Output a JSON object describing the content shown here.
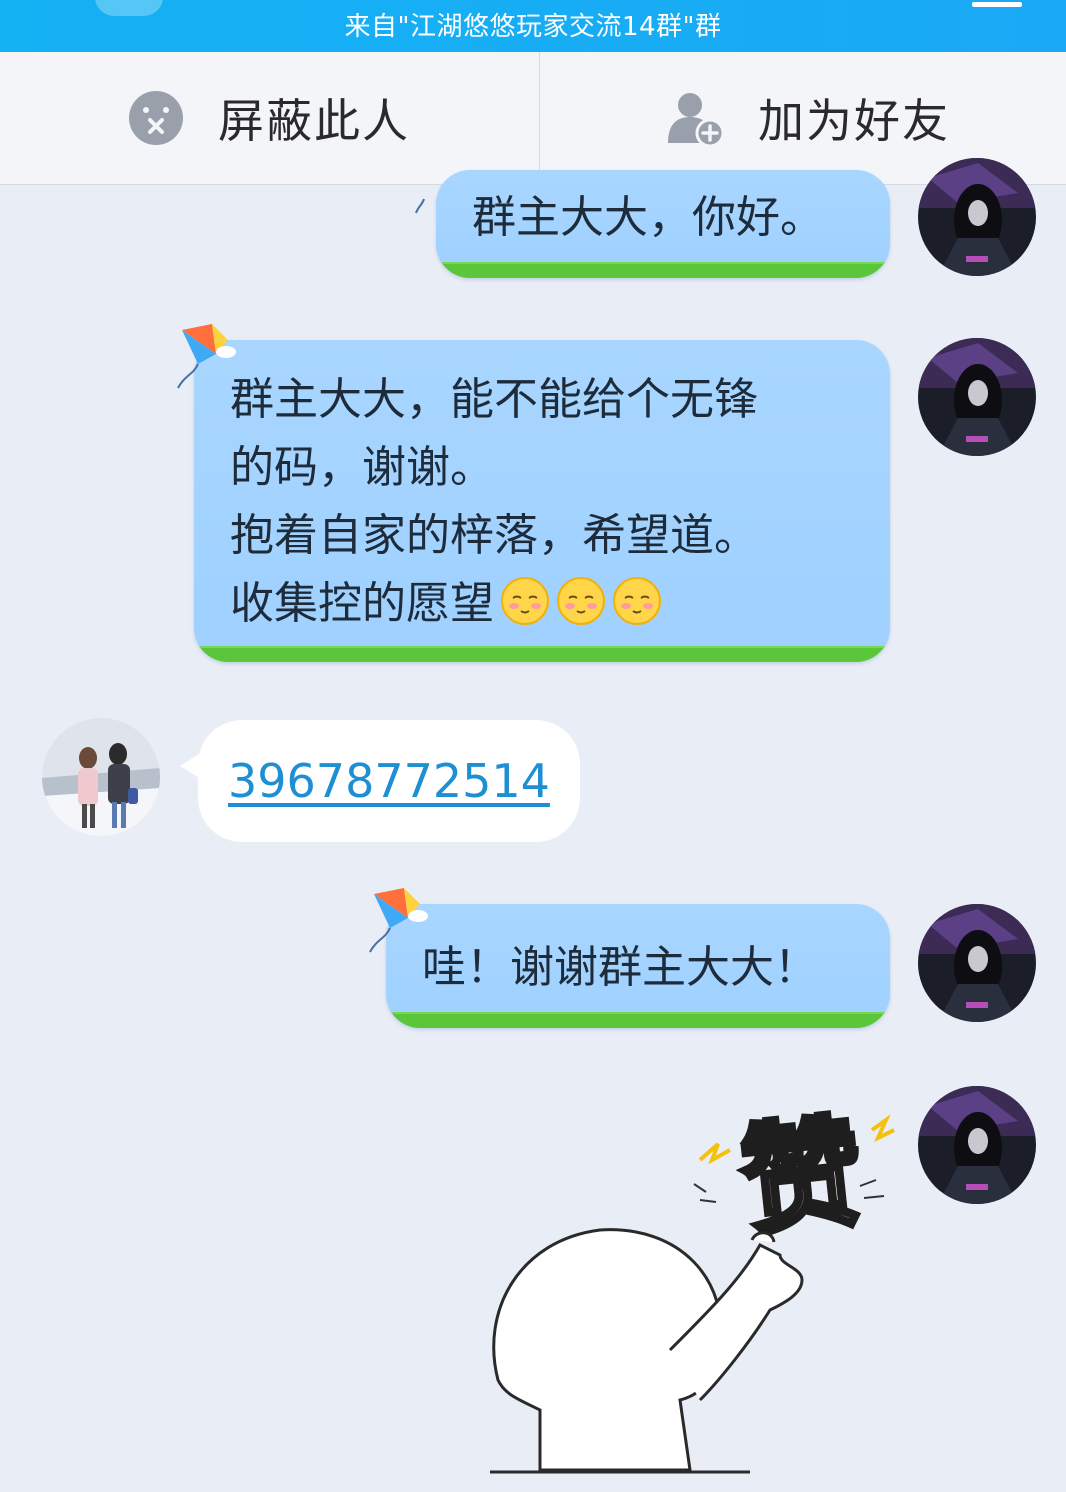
{
  "topbar": {
    "subtitle": "来自\"江湖悠悠玩家交流14群\"群",
    "back_icon": "chevron-left-icon",
    "menu_icon": "menu-icon",
    "color": "#16aef4"
  },
  "actions": {
    "block": {
      "label": "屏蔽此人",
      "icon": "block-icon"
    },
    "add_friend": {
      "label": "加为好友",
      "icon": "add-user-icon"
    }
  },
  "messages": [
    {
      "side": "right",
      "lines": [
        "群主大大，你好。"
      ]
    },
    {
      "side": "right",
      "lines": [
        "群主大大，能不能给个无锋",
        "的码，谢谢。",
        "抱着自家的梓落，希望道。",
        "收集控的愿望"
      ],
      "emoji": "blush-smiley-icon",
      "emoji_count": 3
    },
    {
      "side": "left",
      "link": "39678772514"
    },
    {
      "side": "right",
      "lines": [
        "哇！谢谢群主大大！"
      ]
    },
    {
      "side": "right",
      "sticker": "赞"
    }
  ],
  "colors": {
    "bubble_blue": "#a8d6ff",
    "grass_green": "#5cc63a",
    "link_blue": "#1f8fd3",
    "background": "#e9edf5"
  }
}
